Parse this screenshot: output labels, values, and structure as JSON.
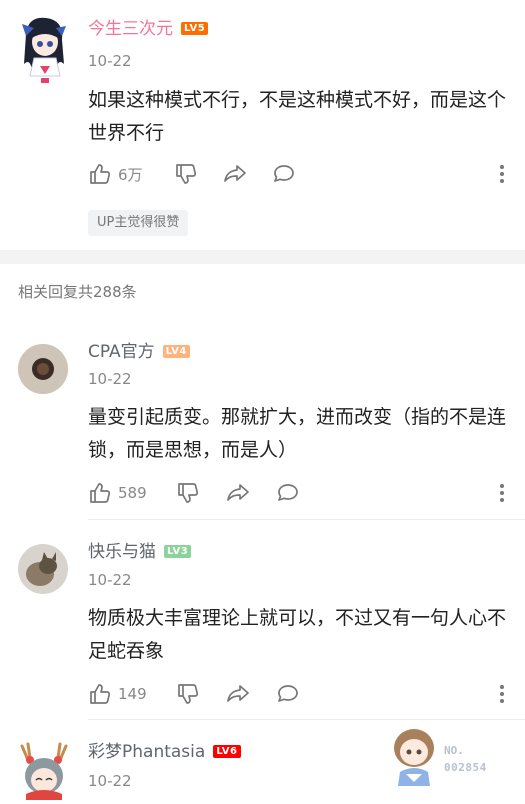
{
  "colors": {
    "vip_name": "#fb7299",
    "normal_name": "#61666d",
    "lv3": "#8bd29b",
    "lv4": "#ffb37c",
    "lv5": "#ff6c00",
    "lv6": "#ff0000"
  },
  "main_comment": {
    "username": "今生三次元",
    "level": "LV5",
    "date": "10-22",
    "text": "如果这种模式不行，不是这种模式不好，而是这个世界不行",
    "likes": "6万",
    "up_badge": "UP主觉得很赞"
  },
  "section_title": "相关回复共288条",
  "replies": [
    {
      "username": "CPA官方",
      "level": "LV4",
      "date": "10-22",
      "text": "量变引起质变。那就扩大，进而改变（指的不是连锁，而是思想，而是人）",
      "likes": "589"
    },
    {
      "username": "快乐与猫",
      "level": "LV3",
      "date": "10-22",
      "text": "物质极大丰富理论上就可以，不过又有一句人心不足蛇吞象",
      "likes": "149"
    },
    {
      "username": "彩梦Phantasia",
      "level": "LV6",
      "date": "10-22"
    }
  ],
  "sticker": {
    "no_label": "NO.",
    "number": "002854"
  },
  "icons": [
    "thumb-up-icon",
    "thumb-down-icon",
    "share-icon",
    "comment-icon",
    "more-icon"
  ]
}
